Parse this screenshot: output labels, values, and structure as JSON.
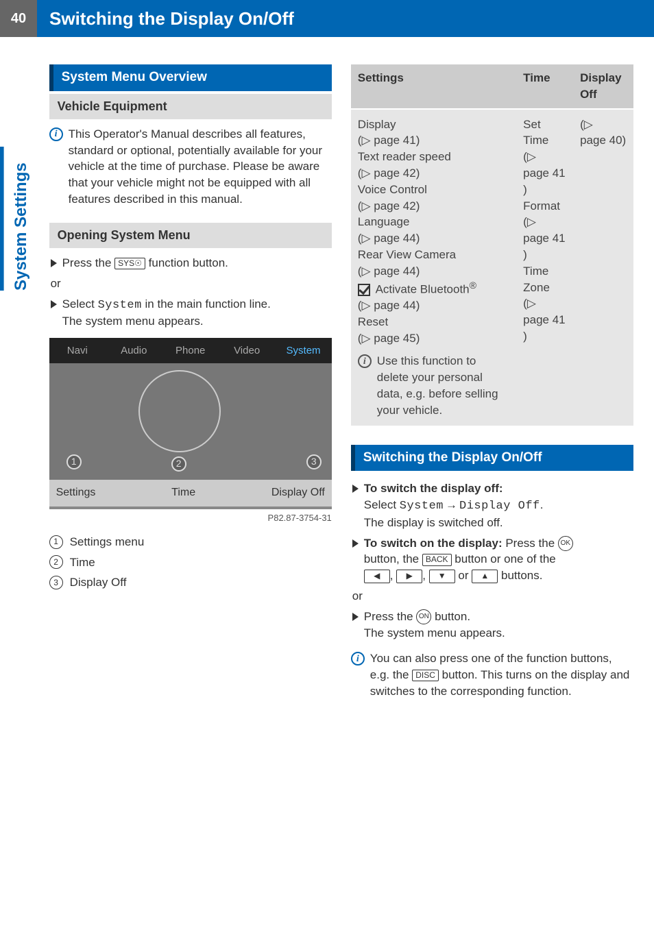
{
  "page_number": "40",
  "header_title": "Switching the Display On/Off",
  "side_tab": "System Settings",
  "left": {
    "section1_title": "System Menu Overview",
    "subsection1_title": "Vehicle Equipment",
    "info1": "This Operator's Manual describes all features, standard or optional, potentially available for your vehicle at the time of purchase. Please be aware that your vehicle might not be equipped with all features described in this manual.",
    "subsection2_title": "Opening System Menu",
    "step1_a": "Press the ",
    "step1_key": "SYS",
    "step1_b": " function button.",
    "or": "or",
    "step2_a": "Select ",
    "step2_mono": "System",
    "step2_b": " in the main function line.",
    "step2_c": "The system menu appears.",
    "figure": {
      "tabs": [
        "Navi",
        "Audio",
        "Phone",
        "Video",
        "System"
      ],
      "footer": [
        "Settings",
        "Time",
        "Display Off"
      ],
      "caption": "P82.87-3754-31"
    },
    "legend": [
      {
        "n": "1",
        "t": "Settings menu"
      },
      {
        "n": "2",
        "t": "Time"
      },
      {
        "n": "3",
        "t": "Display Off"
      }
    ]
  },
  "table": {
    "head": [
      "Settings",
      "Time",
      "Display Off"
    ],
    "settings": {
      "l1": "Display",
      "p1": "page 41",
      "l2": "Text reader speed",
      "p2": "page 42",
      "l3": "Voice Control",
      "p3": "page 42",
      "l4": "Language",
      "p4": "page 44",
      "l5": "Rear View Camera",
      "p5": "page 44",
      "l6": "Activate Bluetooth",
      "p6": "page 44",
      "l7": "Reset",
      "p7": "page 45",
      "note": "Use this function to delete your personal data, e.g. before selling your vehicle."
    },
    "time": {
      "l1": "Set Time",
      "p1": "page 41",
      "l2": "Format",
      "p2": "page 41",
      "l3": "Time Zone",
      "p3": "page 41"
    },
    "display_off": {
      "p": "page 40"
    }
  },
  "right": {
    "section_title": "Switching the Display On/Off",
    "s1_lead": "To switch the display off:",
    "s1_a": "Select ",
    "s1_m1": "System",
    "s1_arrow": "→",
    "s1_m2": "Display Off",
    "s1_b": ".",
    "s1_c": "The display is switched off.",
    "s2_lead": "To switch on the display:",
    "s2_a": " Press the ",
    "s2_b": "button, the ",
    "s2_key": "BACK",
    "s2_c": " button or one of the",
    "s2_d": " buttons.",
    "or": "or",
    "s3_a": "Press the ",
    "s3_b": " button.",
    "s3_c": "The system menu appears.",
    "info": "You can also press one of the function buttons, e.g. the ",
    "info_key": "DISC",
    "info2": " button. This turns on the display and switches to the corresponding function."
  }
}
